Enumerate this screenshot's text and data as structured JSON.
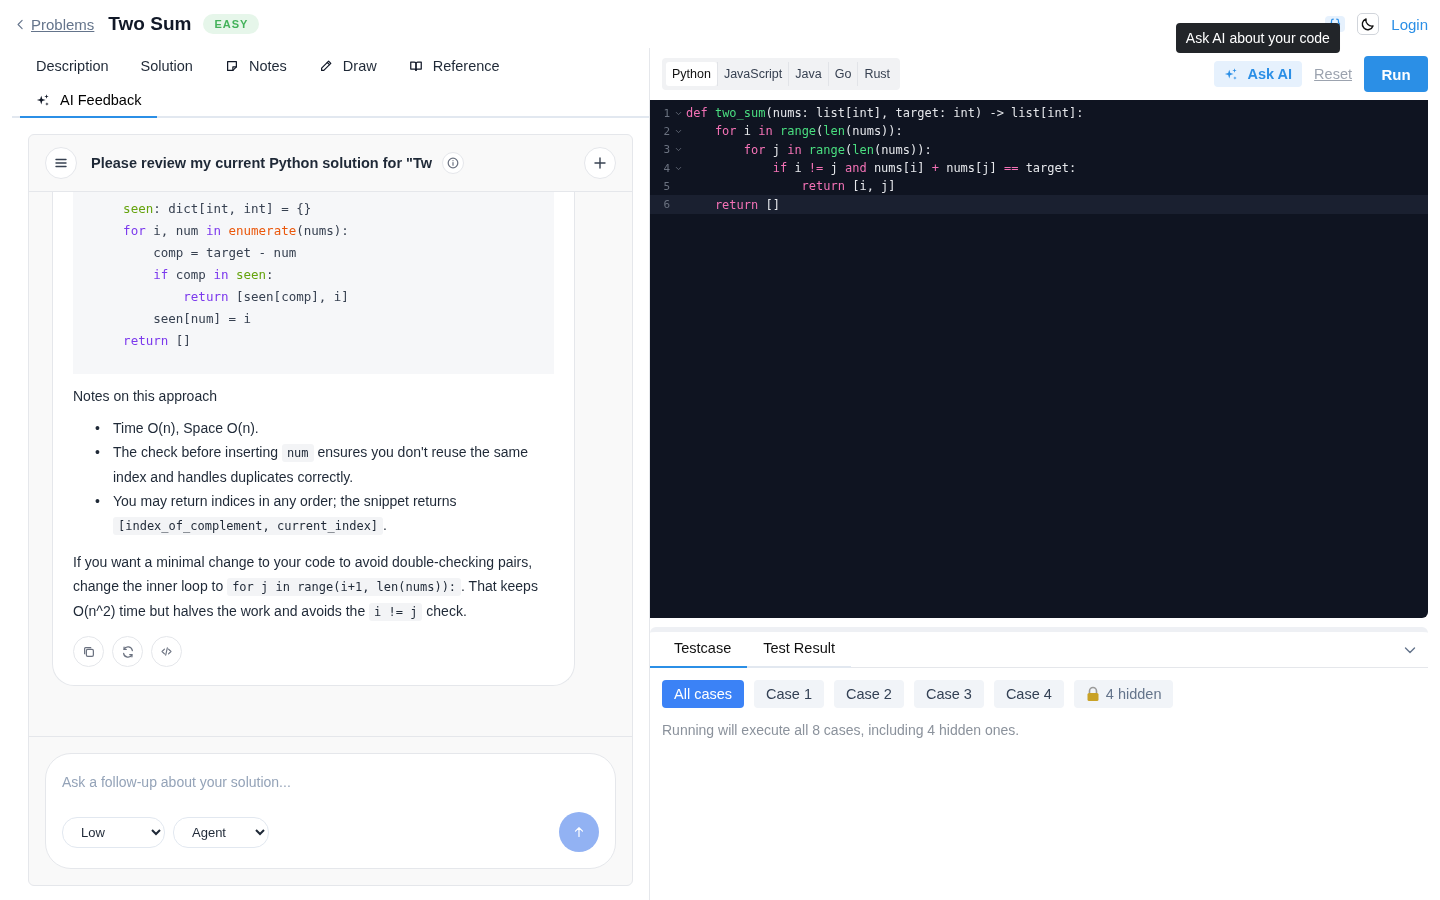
{
  "header": {
    "back_link": "Problems",
    "title": "Two Sum",
    "difficulty": "EASY",
    "login": "Login"
  },
  "left_tabs": [
    {
      "label": "Description",
      "kind": "plain",
      "selected": false
    },
    {
      "label": "Solution",
      "kind": "plain",
      "selected": false
    },
    {
      "label": "Notes",
      "kind": "note",
      "selected": false
    },
    {
      "label": "Draw",
      "kind": "pencil",
      "selected": false
    },
    {
      "label": "Reference",
      "kind": "book",
      "selected": false
    },
    {
      "label": "AI Feedback",
      "kind": "sparkle",
      "selected": true
    }
  ],
  "chat": {
    "title": "Please review my current Python solution for \"Tw",
    "code": [
      [
        {
          "text": "    seen",
          "kind": "var"
        },
        {
          "text": ": dict[int, int] = {}",
          "kind": "plain"
        }
      ],
      [
        {
          "text": "    for",
          "kind": "keyword"
        },
        {
          "text": " i, num ",
          "kind": "plain"
        },
        {
          "text": "in ",
          "kind": "keyword"
        },
        {
          "text": "enumerate",
          "kind": "builtin"
        },
        {
          "text": "(nums):",
          "kind": "plain"
        }
      ],
      [
        {
          "text": "        comp = target - num",
          "kind": "plain"
        }
      ],
      [
        {
          "text": "        if",
          "kind": "keyword"
        },
        {
          "text": " comp ",
          "kind": "plain"
        },
        {
          "text": "in ",
          "kind": "keyword"
        },
        {
          "text": "seen",
          "kind": "var"
        },
        {
          "text": ":",
          "kind": "plain"
        }
      ],
      [
        {
          "text": "            return",
          "kind": "keyword"
        },
        {
          "text": " [seen[comp], i]",
          "kind": "plain"
        }
      ],
      [
        {
          "text": "        seen[num] = i",
          "kind": "plain"
        }
      ],
      [
        {
          "text": "    return",
          "kind": "keyword"
        },
        {
          "text": " []",
          "kind": "plain"
        }
      ]
    ],
    "notes_heading": "Notes on this approach",
    "bullets": [
      {
        "marker": "•",
        "segments": [
          {
            "text": "Time O(n), Space O(n).",
            "kind": "text"
          }
        ]
      },
      {
        "marker": "•",
        "segments": [
          {
            "text": "The check before inserting ",
            "kind": "text"
          },
          {
            "text": "num",
            "kind": "code"
          },
          {
            "text": " ensures you don't reuse the same index and handles duplicates correctly.",
            "kind": "text"
          }
        ]
      },
      {
        "marker": "•",
        "segments": [
          {
            "text": "You may return indices in any order; the snippet returns ",
            "kind": "text"
          },
          {
            "text": "[index_of_complement, current_index]",
            "kind": "code"
          },
          {
            "text": ".",
            "kind": "text"
          }
        ]
      }
    ],
    "paragraph": [
      {
        "text": "If you want a minimal change to your code to avoid double-checking pairs, change the inner loop to ",
        "kind": "text"
      },
      {
        "text": "for j in range(i+1, len(nums)):",
        "kind": "code"
      },
      {
        "text": ". That keeps O(n^2) time but halves the work and avoids the ",
        "kind": "text"
      },
      {
        "text": "i != j",
        "kind": "code"
      },
      {
        "text": " check.",
        "kind": "text"
      }
    ],
    "composer": {
      "placeholder": "Ask a follow-up about your solution...",
      "effort": "Low",
      "mode": "Agent",
      "send_disabled": true
    }
  },
  "editor": {
    "languages": [
      {
        "label": "Python",
        "selected": true
      },
      {
        "label": "JavaScript",
        "selected": false
      },
      {
        "label": "Java",
        "selected": false
      },
      {
        "label": "Go",
        "selected": false
      },
      {
        "label": "Rust",
        "selected": false
      }
    ],
    "ask_ai": "Ask AI",
    "tooltip": "Ask AI about your code",
    "reset": "Reset",
    "run": "Run",
    "lines": [
      {
        "number": "1",
        "foldable": true,
        "active": false,
        "tokens": [
          {
            "text": "def ",
            "kind": "keyword"
          },
          {
            "text": "two_sum",
            "kind": "function"
          },
          {
            "text": "(nums: list[int], target: int) -> list[int]:",
            "kind": "plain"
          }
        ]
      },
      {
        "number": "2",
        "foldable": true,
        "active": false,
        "tokens": [
          {
            "text": "    for",
            "kind": "keyword"
          },
          {
            "text": " i ",
            "kind": "plain"
          },
          {
            "text": "in ",
            "kind": "keyword"
          },
          {
            "text": "range",
            "kind": "function"
          },
          {
            "text": "(",
            "kind": "plain"
          },
          {
            "text": "len",
            "kind": "function"
          },
          {
            "text": "(nums)):",
            "kind": "plain"
          }
        ]
      },
      {
        "number": "3",
        "foldable": true,
        "active": false,
        "tokens": [
          {
            "text": "        for",
            "kind": "keyword"
          },
          {
            "text": " j ",
            "kind": "plain"
          },
          {
            "text": "in ",
            "kind": "keyword"
          },
          {
            "text": "range",
            "kind": "function"
          },
          {
            "text": "(",
            "kind": "plain"
          },
          {
            "text": "len",
            "kind": "function"
          },
          {
            "text": "(nums)):",
            "kind": "plain"
          }
        ]
      },
      {
        "number": "4",
        "foldable": true,
        "active": false,
        "tokens": [
          {
            "text": "            if",
            "kind": "keyword"
          },
          {
            "text": " i ",
            "kind": "plain"
          },
          {
            "text": "!=",
            "kind": "operator"
          },
          {
            "text": " j ",
            "kind": "plain"
          },
          {
            "text": "and",
            "kind": "keyword"
          },
          {
            "text": " nums[i] ",
            "kind": "plain"
          },
          {
            "text": "+",
            "kind": "operator"
          },
          {
            "text": " nums[j] ",
            "kind": "plain"
          },
          {
            "text": "==",
            "kind": "operator"
          },
          {
            "text": " target:",
            "kind": "plain"
          }
        ]
      },
      {
        "number": "5",
        "foldable": false,
        "active": false,
        "tokens": [
          {
            "text": "                return",
            "kind": "keyword"
          },
          {
            "text": " [i, j]",
            "kind": "plain"
          }
        ]
      },
      {
        "number": "6",
        "foldable": false,
        "active": true,
        "tokens": [
          {
            "text": "    return",
            "kind": "keyword"
          },
          {
            "text": " []",
            "kind": "plain"
          }
        ]
      }
    ]
  },
  "testcases": {
    "tabs": [
      {
        "label": "Testcase",
        "selected": true
      },
      {
        "label": "Test Result",
        "selected": false
      }
    ],
    "cases": [
      {
        "label": "All cases",
        "kind": "case",
        "selected": true
      },
      {
        "label": "Case 1",
        "kind": "case",
        "selected": false
      },
      {
        "label": "Case 2",
        "kind": "case",
        "selected": false
      },
      {
        "label": "Case 3",
        "kind": "case",
        "selected": false
      },
      {
        "label": "Case 4",
        "kind": "case",
        "selected": false
      },
      {
        "label": "4 hidden",
        "kind": "locked",
        "selected": false
      }
    ],
    "note": "Running will execute all 8 cases, including 4 hidden ones."
  }
}
